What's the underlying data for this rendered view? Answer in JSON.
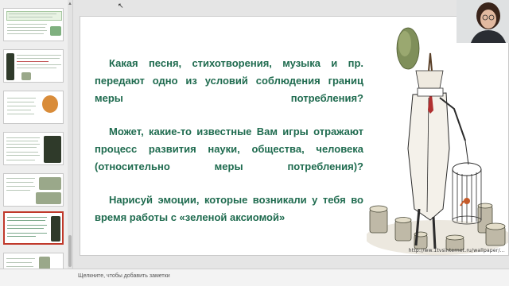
{
  "slide": {
    "paragraphs": [
      "Какая песня, стихотворения, музыка и пр. передают одно из условий соблюдения границ меры потребления?",
      "Может, какие-то известные Вам игры отражают процесс развития науки, общества, человека (относительно меры потребления)?",
      "Нарисуй эмоции, которые возникали у тебя во время работы с «зеленой аксиомой»"
    ],
    "image_url": "http://ww.1tvsinternet.ru/wallpaper/..."
  },
  "notes": {
    "placeholder": "Щелкните, чтобы добавить заметки"
  },
  "thumbnails": {
    "selected_index": 5,
    "count": 7
  },
  "colors": {
    "accent_text": "#1f6b4f",
    "selected_border": "#c0392b"
  }
}
